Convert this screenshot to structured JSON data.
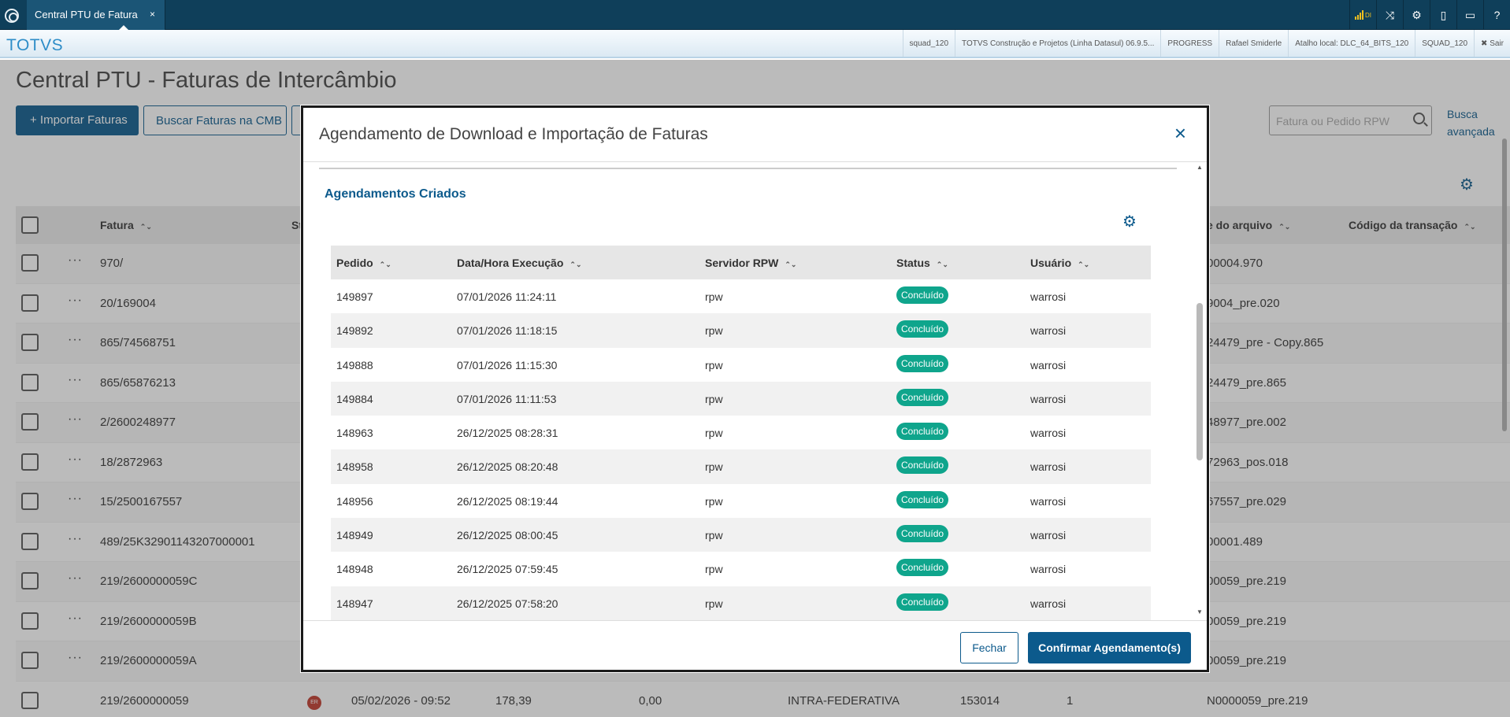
{
  "topbar": {
    "tab_label": "Central PTU de Fatura",
    "tab_close": "×",
    "signal_text": "DI",
    "icons": [
      "signal-icon",
      "shuffle-icon",
      "gear-icon",
      "document-icon",
      "chat-icon",
      "help-icon"
    ]
  },
  "appbar": {
    "brand": "TOTVS",
    "info": [
      "squad_120",
      "TOTVS Construção e Projetos (Linha Datasul) 06.9.5...",
      "PROGRESS",
      "Rafael Smiderle",
      "Atalho local: DLC_64_BITS_120",
      "SQUAD_120"
    ],
    "exit_label": "✖ Sair"
  },
  "page": {
    "title": "Central PTU - Faturas de Intercâmbio",
    "import_button": "+ Importar Faturas",
    "cmb_button": "Buscar Faturas na CMB",
    "search_placeholder": "Fatura ou Pedido RPW",
    "advanced_search": "Busca avançada",
    "columns": {
      "fatura": "Fatura",
      "st": "St",
      "arquivo": "e do arquivo",
      "codigo": "Código da transação"
    },
    "rows": [
      {
        "fatura": "970/",
        "arquivo": "00004.970"
      },
      {
        "fatura": "20/169004",
        "arquivo": "9004_pre.020"
      },
      {
        "fatura": "865/74568751",
        "arquivo": "24479_pre - Copy.865"
      },
      {
        "fatura": "865/65876213",
        "arquivo": "24479_pre.865"
      },
      {
        "fatura": "2/2600248977",
        "arquivo": "48977_pre.002"
      },
      {
        "fatura": "18/2872963",
        "arquivo": "72963_pos.018"
      },
      {
        "fatura": "15/2500167557",
        "arquivo": "67557_pre.029"
      },
      {
        "fatura": "489/25K32901143207000001",
        "arquivo": "00001.489"
      },
      {
        "fatura": "219/2600000059C",
        "arquivo": "00059_pre.219"
      },
      {
        "fatura": "219/2600000059B",
        "arquivo": "00059_pre.219"
      },
      {
        "fatura": "219/2600000059A",
        "arquivo": "00059_pre.219"
      }
    ],
    "last_row": {
      "fatura": "219/2600000059",
      "status": "ER",
      "date": "05/02/2026 - 09:52",
      "v1": "178,39",
      "v2": "0,00",
      "type": "INTRA-FEDERATIVA",
      "num": "153014",
      "q": "1",
      "arquivo": "N0000059_pre.219"
    }
  },
  "modal": {
    "title": "Agendamento de Download e Importação de Faturas",
    "close": "×",
    "section_title": "Agendamentos Criados",
    "columns": {
      "pedido": "Pedido",
      "data": "Data/Hora Execução",
      "servidor": "Servidor RPW",
      "status": "Status",
      "usuario": "Usuário"
    },
    "rows": [
      {
        "pedido": "149897",
        "data": "07/01/2026 11:24:11",
        "servidor": "rpw",
        "status": "Concluído",
        "usuario": "warrosi"
      },
      {
        "pedido": "149892",
        "data": "07/01/2026 11:18:15",
        "servidor": "rpw",
        "status": "Concluído",
        "usuario": "warrosi"
      },
      {
        "pedido": "149888",
        "data": "07/01/2026 11:15:30",
        "servidor": "rpw",
        "status": "Concluído",
        "usuario": "warrosi"
      },
      {
        "pedido": "149884",
        "data": "07/01/2026 11:11:53",
        "servidor": "rpw",
        "status": "Concluído",
        "usuario": "warrosi"
      },
      {
        "pedido": "148963",
        "data": "26/12/2025 08:28:31",
        "servidor": "rpw",
        "status": "Concluído",
        "usuario": "warrosi"
      },
      {
        "pedido": "148958",
        "data": "26/12/2025 08:20:48",
        "servidor": "rpw",
        "status": "Concluído",
        "usuario": "warrosi"
      },
      {
        "pedido": "148956",
        "data": "26/12/2025 08:19:44",
        "servidor": "rpw",
        "status": "Concluído",
        "usuario": "warrosi"
      },
      {
        "pedido": "148949",
        "data": "26/12/2025 08:00:45",
        "servidor": "rpw",
        "status": "Concluído",
        "usuario": "warrosi"
      },
      {
        "pedido": "148948",
        "data": "26/12/2025 07:59:45",
        "servidor": "rpw",
        "status": "Concluído",
        "usuario": "warrosi"
      },
      {
        "pedido": "148947",
        "data": "26/12/2025 07:58:20",
        "servidor": "rpw",
        "status": "Concluído",
        "usuario": "warrosi"
      }
    ],
    "cancel_button": "Fechar",
    "confirm_button": "Confirmar Agendamento(s)"
  }
}
